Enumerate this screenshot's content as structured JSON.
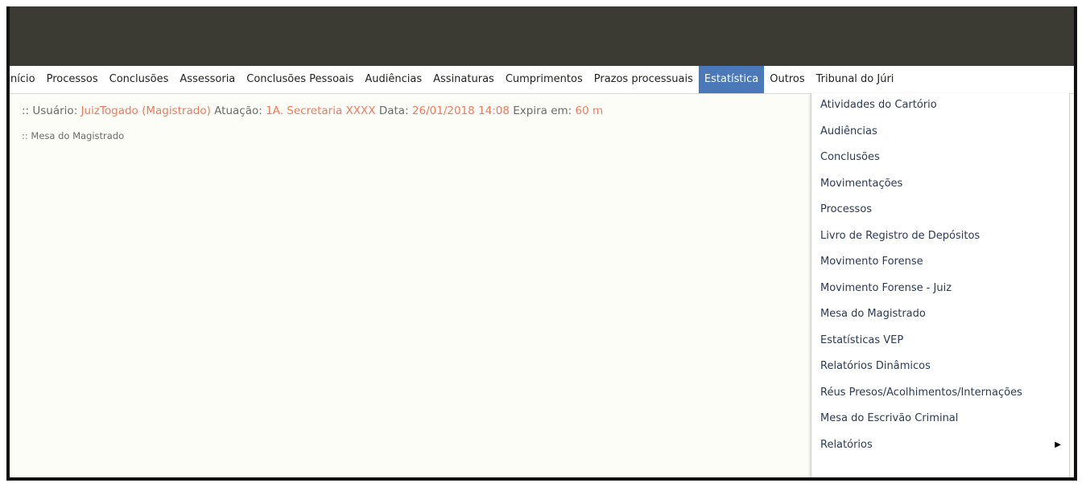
{
  "menu": {
    "items": [
      {
        "label": "nício",
        "active": false
      },
      {
        "label": "Processos",
        "active": false
      },
      {
        "label": "Conclusões",
        "active": false
      },
      {
        "label": "Assessoria",
        "active": false
      },
      {
        "label": "Conclusões Pessoais",
        "active": false
      },
      {
        "label": "Audiências",
        "active": false
      },
      {
        "label": "Assinaturas",
        "active": false
      },
      {
        "label": "Cumprimentos",
        "active": false
      },
      {
        "label": "Prazos processuais",
        "active": false
      },
      {
        "label": "Estatística",
        "active": true
      },
      {
        "label": "Outros",
        "active": false
      },
      {
        "label": "Tribunal do Júri",
        "active": false
      }
    ],
    "active_color": "#4a78b8"
  },
  "info": {
    "usuario_label": ":: Usuário:",
    "usuario_value": "JuizTogado (Magistrado)",
    "atuacao_label": "Atuação:",
    "atuacao_value": "1A. Secretaria XXXX",
    "data_label": "Data:",
    "data_value": "26/01/2018 14:08",
    "expira_label": "Expira em:",
    "expira_value": "60 m",
    "subtitle": ":: Mesa do Magistrado"
  },
  "dropdown": {
    "items": [
      {
        "label": "Atividades do Cartório",
        "has_submenu": false
      },
      {
        "label": "Audiências",
        "has_submenu": false
      },
      {
        "label": "Conclusões",
        "has_submenu": false
      },
      {
        "label": "Movimentações",
        "has_submenu": false
      },
      {
        "label": "Processos",
        "has_submenu": false
      },
      {
        "label": "Livro de Registro de Depósitos",
        "has_submenu": false
      },
      {
        "label": "Movimento Forense",
        "has_submenu": false
      },
      {
        "label": "Movimento Forense - Juiz",
        "has_submenu": false
      },
      {
        "label": "Mesa do Magistrado",
        "has_submenu": false
      },
      {
        "label": "Estatísticas VEP",
        "has_submenu": false
      },
      {
        "label": "Relatórios Dinâmicos",
        "has_submenu": false
      },
      {
        "label": "Réus Presos/Acolhimentos/Internações",
        "has_submenu": false
      },
      {
        "label": "Mesa do Escrivão Criminal",
        "has_submenu": false
      },
      {
        "label": "Relatórios",
        "has_submenu": true
      }
    ],
    "submenu_icon": "triangle-right-icon"
  },
  "colors": {
    "header": "#3b3b33",
    "value_text": "#f07a5f",
    "label_text": "#6b6b6b"
  }
}
